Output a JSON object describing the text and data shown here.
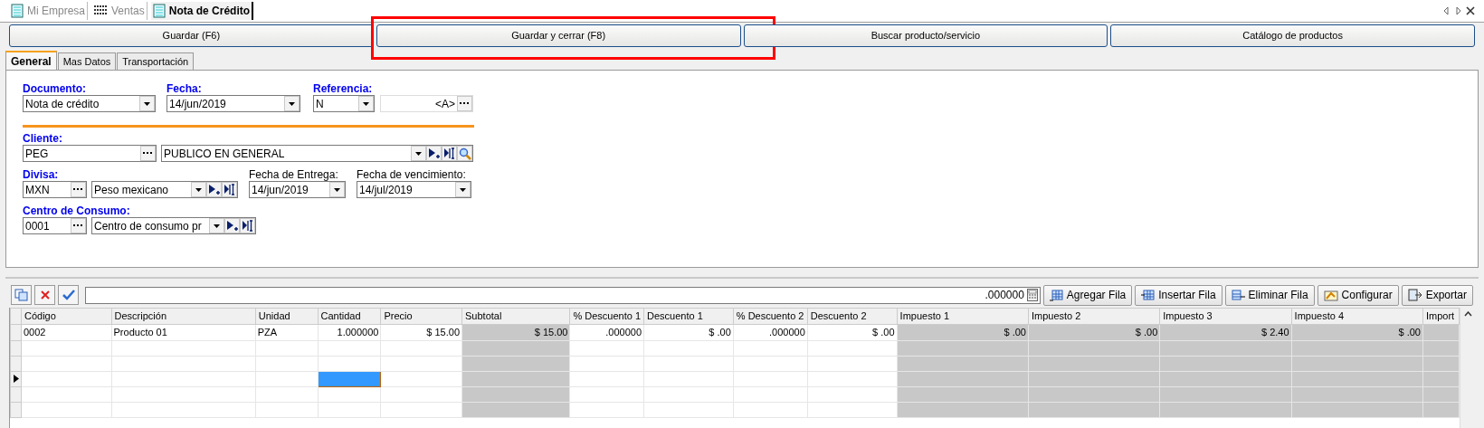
{
  "doc_tabs": [
    {
      "label": "Mi Empresa",
      "kind": "form",
      "selected": false
    },
    {
      "label": "Ventas",
      "kind": "list",
      "selected": false
    },
    {
      "label": "Nota de Crédito",
      "kind": "form",
      "selected": true
    }
  ],
  "buttons": [
    {
      "label": "Guardar (F6)",
      "highlighted": false
    },
    {
      "label": "Guardar y cerrar (F8)",
      "highlighted": true
    },
    {
      "label": "Buscar producto/servicio",
      "highlighted": false
    },
    {
      "label": "Catálogo de productos",
      "highlighted": false
    }
  ],
  "tabs": [
    {
      "label": "General",
      "selected": true
    },
    {
      "label": "Mas Datos",
      "selected": false
    },
    {
      "label": "Transportación",
      "selected": false
    }
  ],
  "form": {
    "documento": {
      "label": "Documento:",
      "required": true,
      "value": "Nota de crédito"
    },
    "fecha": {
      "label": "Fecha:",
      "required": true,
      "value": "14/jun/2019"
    },
    "referencia": {
      "label": "Referencia:",
      "required": true,
      "serie": "N",
      "value": "<A>"
    },
    "cliente": {
      "label": "Cliente:",
      "required": true,
      "code": "PEG",
      "name": "PUBLICO EN GENERAL"
    },
    "divisa": {
      "label": "Divisa:",
      "required": true,
      "code": "MXN",
      "name": "Peso mexicano"
    },
    "fecha_entrega": {
      "label": "Fecha de Entrega:",
      "required": false,
      "value": "14/jun/2019"
    },
    "fecha_vencimiento": {
      "label": "Fecha de vencimiento:",
      "required": false,
      "value": "14/jul/2019"
    },
    "centro": {
      "label": "Centro de Consumo:",
      "required": true,
      "code": "0001",
      "name": "Centro de consumo pr"
    }
  },
  "grid_toolbar": {
    "value": ".000000",
    "buttons": [
      {
        "label": "Agregar Fila",
        "kind": "add"
      },
      {
        "label": "Insertar Fila",
        "kind": "insert"
      },
      {
        "label": "Eliminar Fila",
        "kind": "delete"
      },
      {
        "label": "Configurar",
        "kind": "config"
      },
      {
        "label": "Exportar",
        "kind": "export"
      }
    ]
  },
  "table": {
    "columns": [
      {
        "label": "Código",
        "readonly": false,
        "focused": false
      },
      {
        "label": "Descripción",
        "readonly": false,
        "focused": false
      },
      {
        "label": "Unidad",
        "readonly": false,
        "focused": false
      },
      {
        "label": "Cantidad",
        "readonly": false,
        "focused": true
      },
      {
        "label": "Precio",
        "readonly": false,
        "focused": false
      },
      {
        "label": "Subtotal",
        "readonly": true,
        "focused": false
      },
      {
        "label": "% Descuento 1",
        "readonly": false,
        "focused": false
      },
      {
        "label": "Descuento 1",
        "readonly": false,
        "focused": false
      },
      {
        "label": "% Descuento 2",
        "readonly": false,
        "focused": false
      },
      {
        "label": "Descuento 2",
        "readonly": false,
        "focused": false
      },
      {
        "label": "Impuesto 1",
        "readonly": true,
        "focused": false
      },
      {
        "label": "Impuesto 2",
        "readonly": true,
        "focused": false
      },
      {
        "label": "Impuesto 3",
        "readonly": true,
        "focused": false
      },
      {
        "label": "Impuesto 4",
        "readonly": true,
        "focused": false
      },
      {
        "label": "Import",
        "readonly": true,
        "focused": false
      }
    ],
    "rows": [
      {
        "current": false,
        "cells": [
          "0002",
          "Producto 01",
          "PZA",
          "1.000000",
          "$ 15.00",
          "$ 15.00",
          ".000000",
          "$ .00",
          ".000000",
          "$ .00",
          "$ .00",
          "$ .00",
          "$ 2.40",
          "$ .00"
        ]
      },
      {
        "current": false
      },
      {
        "current": false
      },
      {
        "current": true
      },
      {
        "current": false
      },
      {
        "current": false
      }
    ]
  }
}
